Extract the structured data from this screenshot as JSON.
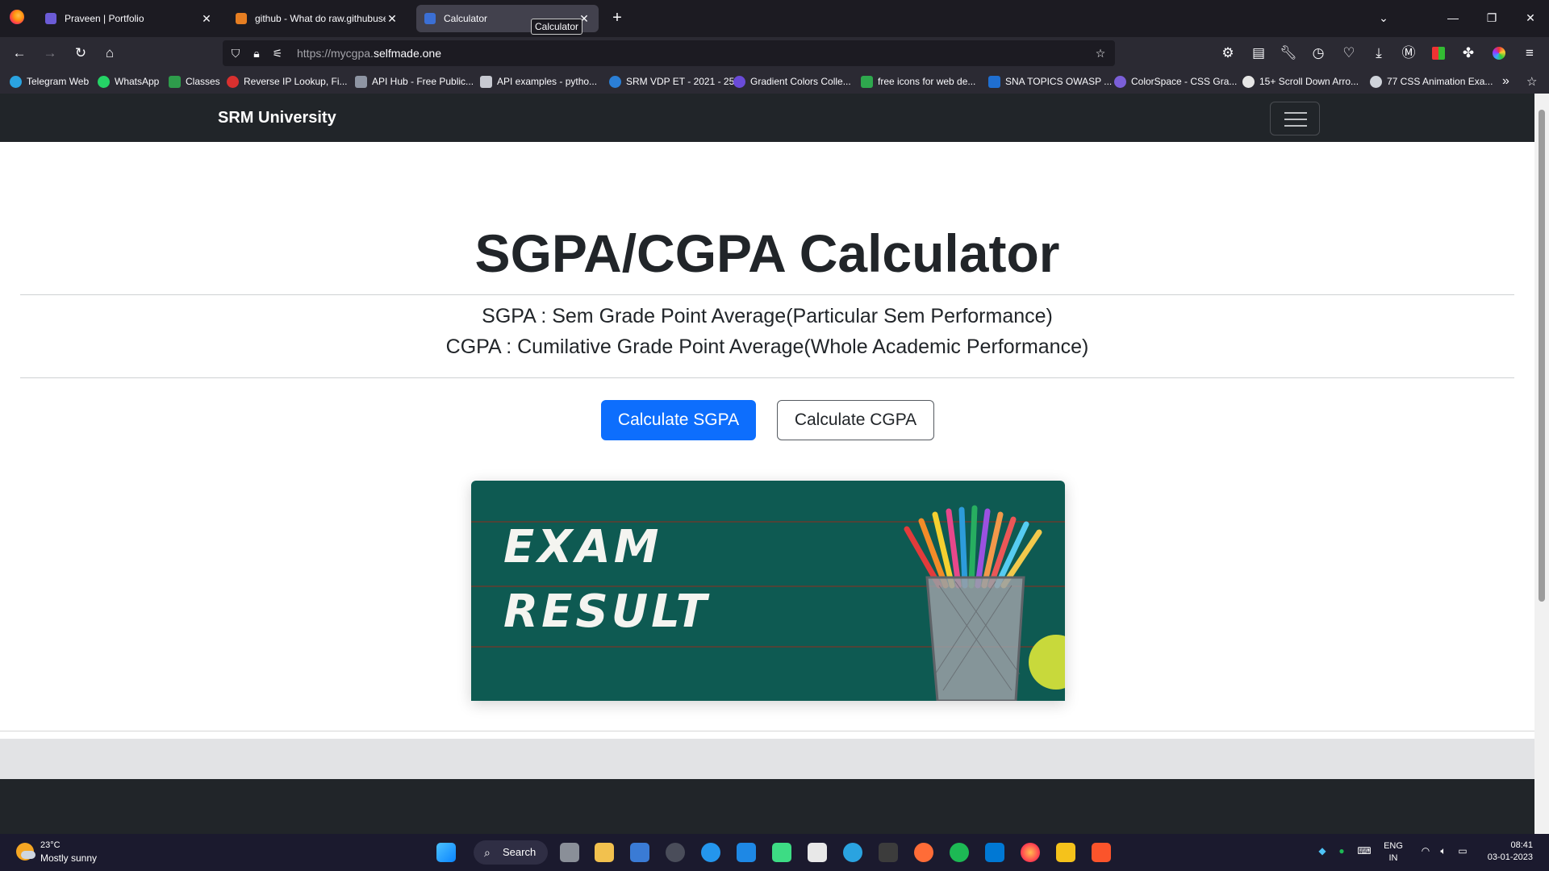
{
  "browser": {
    "tabs": [
      {
        "title": "Praveen | Portfolio",
        "favicon_color": "#6b5bd6"
      },
      {
        "title": "github - What do raw.githubusercontent.com",
        "favicon_color": "#e67e22"
      },
      {
        "title": "Calculator",
        "favicon_color": "#3b6fd4"
      }
    ],
    "tooltip": "Calculator",
    "new_tab_icon": "+",
    "url_dim": "https://mycgpa.",
    "url_domain": "selfmade.one",
    "bookmarks": [
      {
        "label": "Telegram Web",
        "color": "#2aa3e0"
      },
      {
        "label": "WhatsApp",
        "color": "#25d366"
      },
      {
        "label": "Classes",
        "color": "#2e9c4b"
      },
      {
        "label": "Reverse IP Lookup, Fi...",
        "color": "#d9302f"
      },
      {
        "label": "API Hub - Free Public...",
        "color": "#8e95a3"
      },
      {
        "label": "API examples - pytho...",
        "color": "#c7c9d1"
      },
      {
        "label": "SRM VDP ET - 2021 - 25",
        "color": "#2b7fd6"
      },
      {
        "label": "Gradient Colors Colle...",
        "color": "#6a4bd8"
      },
      {
        "label": "free icons for web de...",
        "color": "#2ea84d"
      },
      {
        "label": "SNA TOPICS OWASP ...",
        "color": "#1f6fd1"
      },
      {
        "label": "ColorSpace - CSS Gra...",
        "color": "#7b5fd8"
      },
      {
        "label": "15+ Scroll Down Arro...",
        "color": "#e6e6e6"
      },
      {
        "label": "77 CSS Animation Exa...",
        "color": "#cfd3da"
      }
    ]
  },
  "page": {
    "brand": "SRM University",
    "heading": "SGPA/CGPA Calculator",
    "sgpa_desc": "SGPA : Sem Grade Point Average(Particular Sem Performance)",
    "cgpa_desc": "CGPA : Cumilative Grade Point Average(Whole Academic Performance)",
    "btn_sgpa": "Calculate SGPA",
    "btn_cgpa": "Calculate CGPA",
    "hero_line1": "EXAM",
    "hero_line2": "RESULT"
  },
  "taskbar": {
    "temperature": "23°C",
    "weather": "Mostly sunny",
    "search_label": "Search",
    "lang1": "ENG",
    "lang2": "IN",
    "time": "08:41",
    "date": "03-01-2023"
  }
}
